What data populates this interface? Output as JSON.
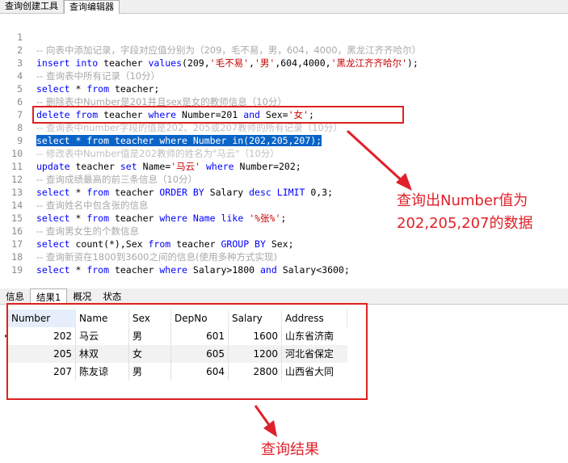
{
  "top_tabs": [
    {
      "label": "查询创建工具",
      "active": false
    },
    {
      "label": "查询编辑器",
      "active": true
    }
  ],
  "editor": {
    "lines": [
      {
        "n": "1"
      },
      {
        "n": "2"
      },
      {
        "n": "3"
      },
      {
        "n": "4"
      },
      {
        "n": "5"
      },
      {
        "n": "6"
      },
      {
        "n": "7"
      },
      {
        "n": "8"
      },
      {
        "n": "9"
      },
      {
        "n": "10"
      },
      {
        "n": "11"
      },
      {
        "n": "12"
      },
      {
        "n": "13"
      },
      {
        "n": "14"
      },
      {
        "n": "15"
      },
      {
        "n": "16"
      },
      {
        "n": "17"
      },
      {
        "n": "18"
      },
      {
        "n": "19"
      }
    ],
    "l1": "-- 向表中添加记录，字段对应值分别为（209，毛不易，男，604，4000，黑龙江齐齐哈尔）",
    "l2_a": "insert into",
    "l2_b": " teacher ",
    "l2_c": "values",
    "l2_d": "(209,",
    "l2_e": "'毛不易'",
    "l2_f": ",",
    "l2_g": "'男'",
    "l2_h": ",604,4000,",
    "l2_i": "'黑龙江齐齐哈尔'",
    "l2_j": ");",
    "l3": "-- 查询表中所有记录（10分）",
    "l4_a": "select",
    "l4_b": " * ",
    "l4_c": "from",
    "l4_d": " teacher;",
    "l5": "-- 删除表中Number是201并且sex是女的教师信息（10分）",
    "l6_a": "delete from",
    "l6_b": " teacher ",
    "l6_c": "where",
    "l6_d": " Number=201 ",
    "l6_e": "and",
    "l6_f": " Sex=",
    "l6_g": "'女'",
    "l6_h": ";",
    "l7": "-- 查询表中number字段的值是202、205或207教师的所有记录（10分）",
    "l8": "select * from teacher where Number in(202,205,207);",
    "l9": "-- 修改表中Number值是202教师的姓名为\"马云\"（10分）",
    "l10_a": "update",
    "l10_b": " teacher ",
    "l10_c": "set",
    "l10_d": " Name=",
    "l10_e": "'马云'",
    "l10_f": " ",
    "l10_g": "where",
    "l10_h": " Number=202;",
    "l11": "-- 查询成绩最高的前三条信息（10分）",
    "l12_a": "select",
    "l12_b": " * ",
    "l12_c": "from",
    "l12_d": " teacher ",
    "l12_e": "ORDER BY",
    "l12_f": " Salary ",
    "l12_g": "desc",
    "l12_h": " ",
    "l12_i": "LIMIT",
    "l12_j": " 0,3;",
    "l13": "-- 查询姓名中包含张的信息",
    "l14_a": "select",
    "l14_b": " * ",
    "l14_c": "from",
    "l14_d": " teacher ",
    "l14_e": "where",
    "l14_f": " ",
    "l14_g": "Name",
    "l14_h": " ",
    "l14_i": "like",
    "l14_j": " ",
    "l14_k": "'%张%'",
    "l14_l": ";",
    "l15": "-- 查询男女生的个数信息",
    "l16_a": "select",
    "l16_b": " count(*),Sex ",
    "l16_c": "from",
    "l16_d": " teacher ",
    "l16_e": "GROUP BY",
    "l16_f": " Sex;",
    "l17": "-- 查询新资在1800到3600之间的信息(使用多种方式实现)",
    "l18_a": "select",
    "l18_b": " * ",
    "l18_c": "from",
    "l18_d": " teacher ",
    "l18_e": "where",
    "l18_f": " Salary>1800 ",
    "l18_g": "and",
    "l18_h": " Salary<3600;"
  },
  "annotations": {
    "query_note_line1": "查询出Number值为",
    "query_note_line2": "202,205,207的数据",
    "result_note": "查询结果",
    "color": "#e0202a"
  },
  "bottom_tabs": [
    {
      "label": "信息",
      "active": false
    },
    {
      "label": "结果1",
      "active": true
    },
    {
      "label": "概况",
      "active": false
    },
    {
      "label": "状态",
      "active": false
    }
  ],
  "results": {
    "columns": [
      "Number",
      "Name",
      "Sex",
      "DepNo",
      "Salary",
      "Address"
    ],
    "rows": [
      [
        "202",
        "马云",
        "男",
        "601",
        "1600",
        "山东省济南"
      ],
      [
        "205",
        "林双",
        "女",
        "605",
        "1200",
        "河北省保定"
      ],
      [
        "207",
        "陈友谅",
        "男",
        "604",
        "2800",
        "山西省大同"
      ]
    ]
  }
}
